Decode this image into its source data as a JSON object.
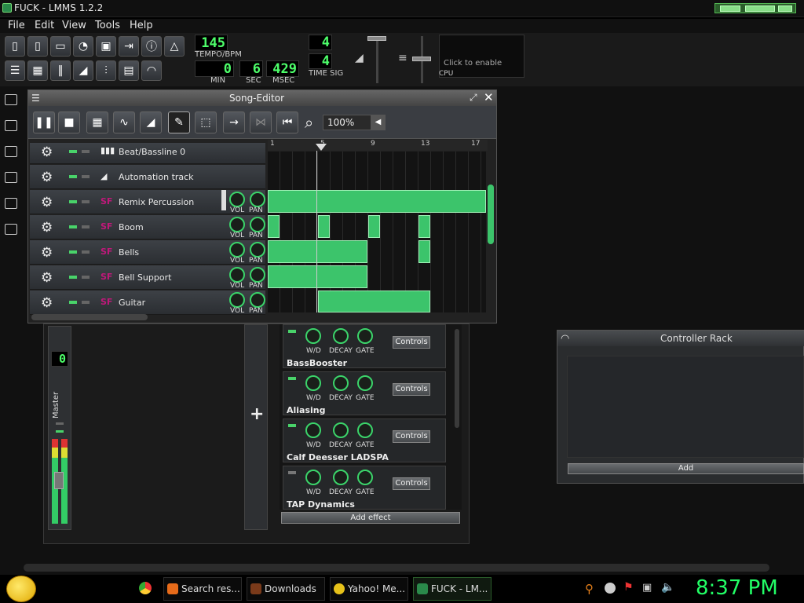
{
  "window": {
    "title": "FUCK - LMMS 1.2.2"
  },
  "menu": [
    "File",
    "Edit",
    "View",
    "Tools",
    "Help"
  ],
  "transport": {
    "tempo": "145",
    "tempo_label": "TEMPO/BPM",
    "time_min": "0",
    "time_sec": "6",
    "time_msec": "429",
    "min_label": "MIN",
    "sec_label": "SEC",
    "msec_label": "MSEC",
    "sig_num": "4",
    "sig_den": "4",
    "sig_label": "TIME SIG",
    "cpu_hint": "Click to enable",
    "cpu_label": "CPU"
  },
  "song_editor": {
    "title": "Song-Editor",
    "zoom": "100%",
    "ruler": [
      "1",
      "5",
      "9",
      "13",
      "17"
    ],
    "tracks": [
      {
        "name": "Beat/Bassline 0",
        "type": "bb"
      },
      {
        "name": "Automation track",
        "type": "automation"
      },
      {
        "name": "Remix Percussion",
        "type": "instrument",
        "vol": "VOL",
        "pan": "PAN"
      },
      {
        "name": "Boom",
        "type": "instrument",
        "vol": "VOL",
        "pan": "PAN"
      },
      {
        "name": "Bells",
        "type": "instrument",
        "vol": "VOL",
        "pan": "PAN"
      },
      {
        "name": "Bell Support",
        "type": "instrument",
        "vol": "VOL",
        "pan": "PAN"
      },
      {
        "name": "Guitar",
        "type": "instrument",
        "vol": "VOL",
        "pan": "PAN"
      }
    ],
    "track_icon_text": "SF"
  },
  "fx_mixer": {
    "master_label": "Master",
    "master_lcd": "0",
    "effects": [
      {
        "name": "BassBooster",
        "enabled": true
      },
      {
        "name": "Aliasing",
        "enabled": true
      },
      {
        "name": "Calf Deesser LADSPA",
        "enabled": true
      },
      {
        "name": "TAP Dynamics",
        "enabled": false
      }
    ],
    "knob_labels": [
      "W/D",
      "DECAY",
      "GATE"
    ],
    "controls_label": "Controls",
    "add_effect": "Add effect",
    "add_channel": "+"
  },
  "controller_rack": {
    "title": "Controller Rack",
    "add": "Add"
  },
  "taskbar": {
    "items": [
      "Search res...",
      "Downloads",
      "Yahoo! Me...",
      "FUCK - LM..."
    ],
    "clock": "8:37 PM"
  },
  "colors": {
    "accent": "#3cc46b",
    "lcd": "#4dff6a",
    "clock": "#22ff66"
  }
}
